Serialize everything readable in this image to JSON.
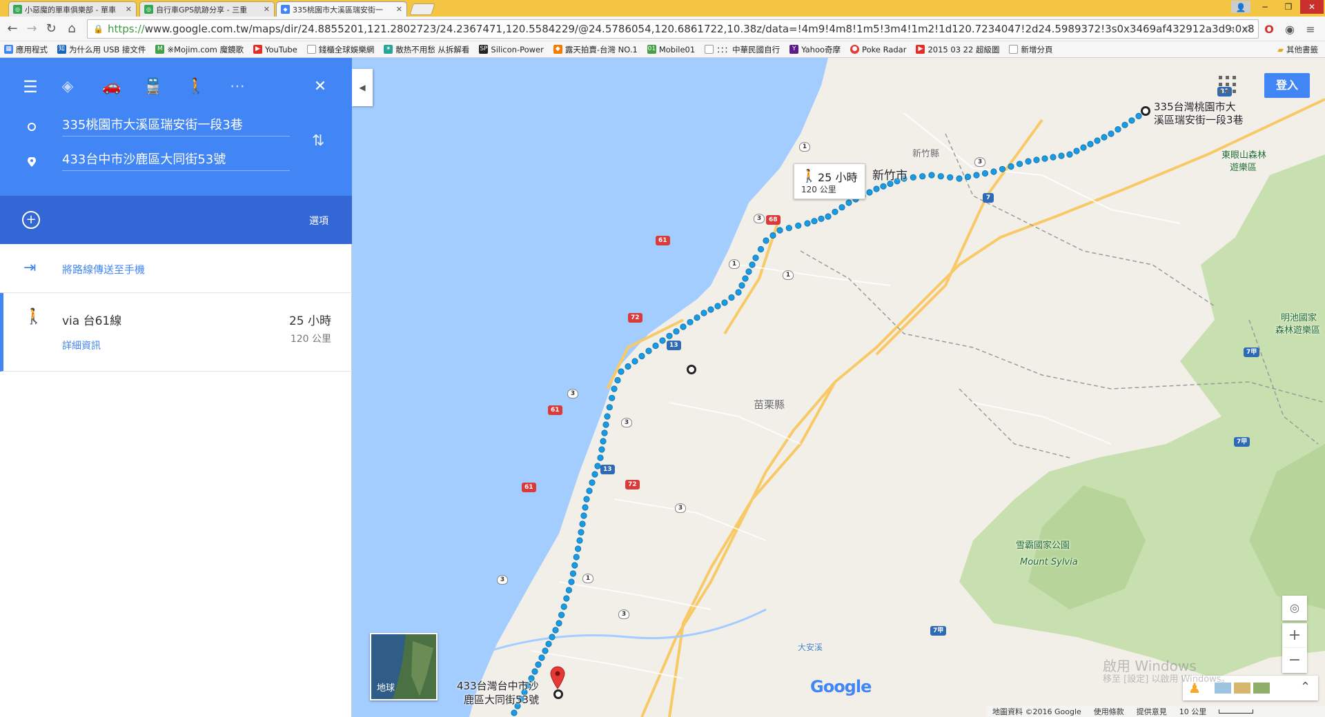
{
  "browser": {
    "tabs": [
      {
        "title": "小惡魔的單車俱樂部 - 單車",
        "icon": "forum-icon"
      },
      {
        "title": "自行車GPS航跡分享 - 三重",
        "icon": "forum-icon"
      },
      {
        "title": "335桃園市大溪區瑞安街一",
        "icon": "maps-icon"
      }
    ],
    "url_scheme": "https://",
    "url_rest": "www.google.com.tw/maps/dir/24.8855201,121.2802723/24.2367471,120.5584229/@24.5786054,120.6861722,10.38z/data=!4m9!4m8!1m5!3m4!1m2!1d120.7234047!2d24.5989372!3s0x3469af432912a3d9:0x8",
    "bookmarks": [
      {
        "label": "應用程式",
        "icon": "apps-icon",
        "color": "#4285f4"
      },
      {
        "label": "为什么用 USB 接文件",
        "icon": "zhihu-icon",
        "color": "#1565c0"
      },
      {
        "label": "※Mojim.com 魔鏡歌",
        "icon": "mojim-icon",
        "color": "#43a047"
      },
      {
        "label": "YouTube",
        "icon": "youtube-icon",
        "color": "#e52d27"
      },
      {
        "label": "錢櫃全球娛樂網",
        "icon": "page-icon",
        "color": "#999999"
      },
      {
        "label": "散热不用愁 从拆解看",
        "icon": "bolt-icon",
        "color": "#26a69a"
      },
      {
        "label": "Silicon-Power",
        "icon": "sp-icon",
        "color": "#222222"
      },
      {
        "label": "露天拍賣-台灣 NO.1",
        "icon": "ruten-icon",
        "color": "#f57c00"
      },
      {
        "label": "Mobile01",
        "icon": "mobile01-icon",
        "color": "#43a047"
      },
      {
        "label": "：：：中華民國自行",
        "icon": "page-icon",
        "color": "#999999"
      },
      {
        "label": "Yahoo奇摩",
        "icon": "yahoo-icon",
        "color": "#5c1b8a"
      },
      {
        "label": "Poke Radar",
        "icon": "pokeball-icon",
        "color": "#e53935"
      },
      {
        "label": "2015 03 22 超級圖",
        "icon": "youtube-icon",
        "color": "#e52d27"
      },
      {
        "label": "新增分頁",
        "icon": "page-icon",
        "color": "#999999"
      }
    ],
    "other_bookmarks": "其他書籤"
  },
  "sidebar": {
    "origin": "335桃園市大溪區瑞安街一段3巷",
    "destination": "433台中市沙鹿區大同街53號",
    "options_label": "選項",
    "send_to_phone": "將路線傳送至手機",
    "route": {
      "via": "via 台61線",
      "duration": "25 小時",
      "distance": "120 公里",
      "details": "詳細資訊"
    }
  },
  "map": {
    "signin": "登入",
    "callout_duration": "25 小時",
    "callout_distance": "120 公里",
    "origin_label_1": "335台灣桃園市大",
    "origin_label_2": "溪區瑞安街一段3巷",
    "dest_label_1": "433台灣台中市沙",
    "dest_label_2": "鹿區大同街53號",
    "places": {
      "hsinchu_city": "新竹市",
      "hsinchu_county": "新竹縣",
      "miaoli_county": "苗栗縣",
      "dongyanshan_1": "東眼山森林",
      "dongyanshan_2": "遊樂區",
      "mingchi_1": "明池國家",
      "mingchi_2": "森林遊樂區",
      "shei_pa": "雪霸國家公園",
      "mount_sylvia": "Mount Sylvia",
      "daan_river": "大安溪"
    },
    "road_shields": [
      "31",
      "1",
      "3",
      "7",
      "68",
      "3",
      "1",
      "61",
      "1",
      "13",
      "72",
      "3",
      "61",
      "3",
      "13",
      "72",
      "3",
      "61",
      "1",
      "3",
      "7甲",
      "7甲",
      "7甲",
      "3"
    ],
    "earth_label": "地球",
    "google_logo": "Google",
    "footer": {
      "data": "地圖資料 ©2016 Google",
      "terms": "使用條款",
      "feedback": "提供意見",
      "scale": "10 公里"
    },
    "watermark_1": "啟用 Windows",
    "watermark_2": "移至 [設定] 以啟用 Windows。"
  },
  "colors": {
    "sea": "#a3ccff",
    "land": "#f2efe9",
    "forest": "#c8dfb0",
    "route": "#1a9ae0",
    "header_blue": "#4285f4",
    "options_blue": "#3367d6",
    "road_major": "#f8c967"
  }
}
